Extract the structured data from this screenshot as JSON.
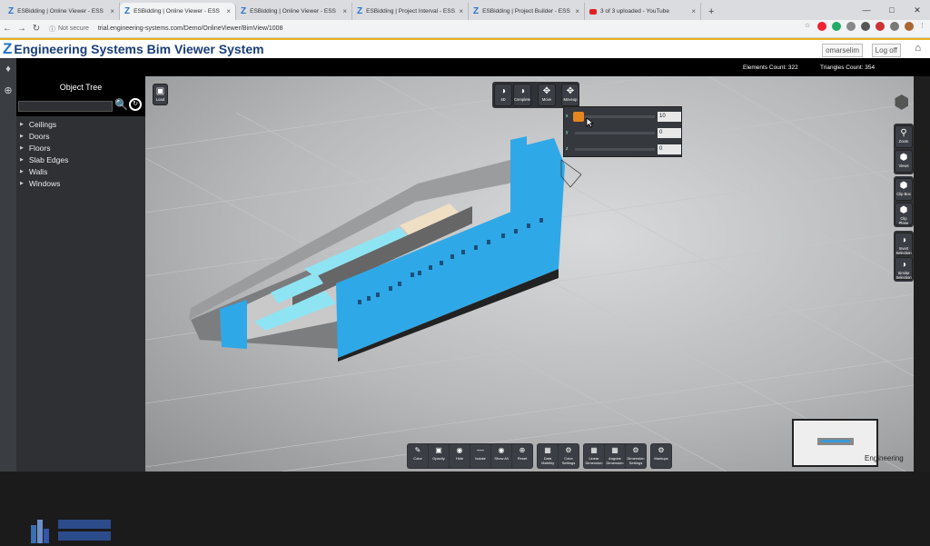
{
  "browser": {
    "tabs": [
      {
        "title": "ESBidding | Online Viewer - ESS",
        "icon": "z-logo-icon",
        "active": false
      },
      {
        "title": "ESBidding | Online Viewer - ESS",
        "icon": "z-logo-icon",
        "active": true
      },
      {
        "title": "ESBidding | Online Viewer - ESS",
        "icon": "z-logo-icon",
        "active": false
      },
      {
        "title": "ESBidding | Project Interval - ESS",
        "icon": "z-logo-icon",
        "active": false
      },
      {
        "title": "ESBidding | Project Builder - ESS",
        "icon": "z-logo-icon",
        "active": false
      },
      {
        "title": "3 of 3 uploaded - YouTube",
        "icon": "youtube-icon",
        "active": false
      }
    ],
    "new_tab": "+",
    "not_secure": "Not secure",
    "url": "trial.engineering-systems.com/Demo/OnlineViewer/BimView/1008"
  },
  "app": {
    "logo": "Z",
    "title": "Engineering Systems Bim Viewer System",
    "user": "omarselim",
    "logoff": "Log off"
  },
  "stats": {
    "elements": "Elements Count: 322",
    "triangles": "Triangles Count: 354"
  },
  "tree": {
    "title": "Object Tree",
    "items": [
      "Ceilings",
      "Doors",
      "Floors",
      "Slab Edges",
      "Walls",
      "Windows"
    ]
  },
  "viewer": {
    "load": "Load",
    "top_buttons": [
      "4D",
      "Complete",
      "Move",
      "Moveup"
    ],
    "panel_rows": [
      {
        "label": "x",
        "value": "10"
      },
      {
        "label": "y",
        "value": "0"
      },
      {
        "label": "z",
        "value": "0"
      }
    ],
    "right_buttons": [
      [
        "Zoom",
        "Views"
      ],
      [
        "Clip Box",
        "Clip Plane"
      ],
      [
        "Invert Selection",
        "Similar Selection"
      ]
    ],
    "bottom_groups": [
      [
        "Color",
        "Opacity",
        "Hide",
        "Isolate",
        "Show All",
        "Reset"
      ],
      [
        "Data Visibility",
        "Color Settings"
      ],
      [
        "Linear Dimension",
        "Angular Dimension",
        "Dimension Settings"
      ],
      [
        "Markups"
      ]
    ],
    "brand": "Engineering",
    "accent_color": "#2fa8e8"
  }
}
